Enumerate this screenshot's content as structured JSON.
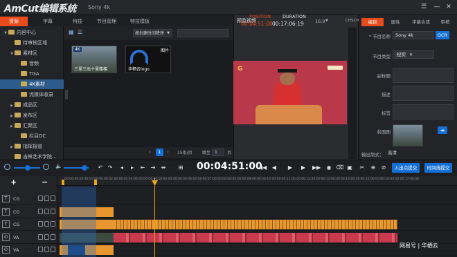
{
  "app": {
    "logo": "AmCut编辑系统",
    "project": "Sony 4k"
  },
  "top_tabs": [
    "资源",
    "字幕",
    "特技",
    "节目管理",
    "特技模板"
  ],
  "tree": [
    {
      "label": "内容中心",
      "level": 0,
      "arrow": "▼"
    },
    {
      "label": "待审核区域",
      "level": 1,
      "arrow": ""
    },
    {
      "label": "素材区",
      "level": 1,
      "arrow": "▼"
    },
    {
      "label": "音频",
      "level": 2,
      "arrow": ""
    },
    {
      "label": "TGA",
      "level": 2,
      "arrow": ""
    },
    {
      "label": "4K素材",
      "level": 2,
      "arrow": "",
      "selected": true
    },
    {
      "label": "流媒体收录",
      "level": 2,
      "arrow": ""
    },
    {
      "label": "成品区",
      "level": 1,
      "arrow": "▶"
    },
    {
      "label": "发布区",
      "level": 1,
      "arrow": "▶"
    },
    {
      "label": "汇聚区",
      "level": 1,
      "arrow": "▶"
    },
    {
      "label": "栏目DC",
      "level": 2,
      "arrow": ""
    },
    {
      "label": "指挥报道",
      "level": 1,
      "arrow": "▶"
    },
    {
      "label": "吉林艺术学院...",
      "level": 1,
      "arrow": ""
    }
  ],
  "media": {
    "sort_label": "按创建时间降序",
    "items": [
      {
        "badge": "4K",
        "caption": "三里三出十里楼梯"
      },
      {
        "badge": "图片",
        "caption": "华栖云logo"
      }
    ],
    "pager": {
      "page": "1",
      "per_page": "15条/页",
      "goto_label": "跳至",
      "goto_value": "1",
      "page_suffix": "页"
    }
  },
  "preview": {
    "label": "预监视频",
    "position_label": "POSITION",
    "duration_label": "DURATION",
    "position": "00:04:51:00",
    "duration": "00:17:06:19",
    "ratio": "16:9",
    "channel": "CHSCH2"
  },
  "props": {
    "tabs": [
      "编目",
      "属性",
      "字幕合成",
      "审核"
    ],
    "fields": [
      {
        "label": "* 节目名称",
        "value": "Sony 4k"
      },
      {
        "label": "节目类型",
        "value": "纪实"
      },
      {
        "label": "副标题",
        "value": ""
      },
      {
        "label": "描述",
        "value": ""
      },
      {
        "label": "标签",
        "value": ""
      },
      {
        "label": "封面图",
        "value": ""
      }
    ],
    "ok": "OCR",
    "output_label": "输出制式：",
    "output_value": "高清"
  },
  "transport": {
    "timecode": "00:04:51:00",
    "btn_left": "入出点提交",
    "btn_right": "时间线提交"
  },
  "timeline": {
    "tracks": [
      {
        "type": "T",
        "name": "CG"
      },
      {
        "type": "T",
        "name": "CG"
      },
      {
        "type": "T",
        "name": "CG"
      },
      {
        "type": "⊙",
        "name": "VA"
      },
      {
        "type": "⊙",
        "name": "VA"
      }
    ],
    "ruler_labels": [
      "00:00:00:00",
      "00:01:00:00",
      "00:02:00:00",
      "00:03:00:00",
      "00:04:00:00",
      "00:05:00:00",
      "00:06:00:00",
      "00:07:00:00",
      "00:08:00:00",
      "00:09:00:00",
      "00:10:00:00",
      "00:11:00:00",
      "00:12:00:00",
      "00:13:00:00",
      "00:14:00:00",
      "00:15:00:00",
      "00:16:00:00",
      "00:17:00:00"
    ]
  },
  "watermark": "网易号 | 华栖云",
  "colors": {
    "accent": "#e94b1c",
    "blue": "#1570d6",
    "orange": "#e8962e",
    "video_bg": "#b9394b"
  }
}
